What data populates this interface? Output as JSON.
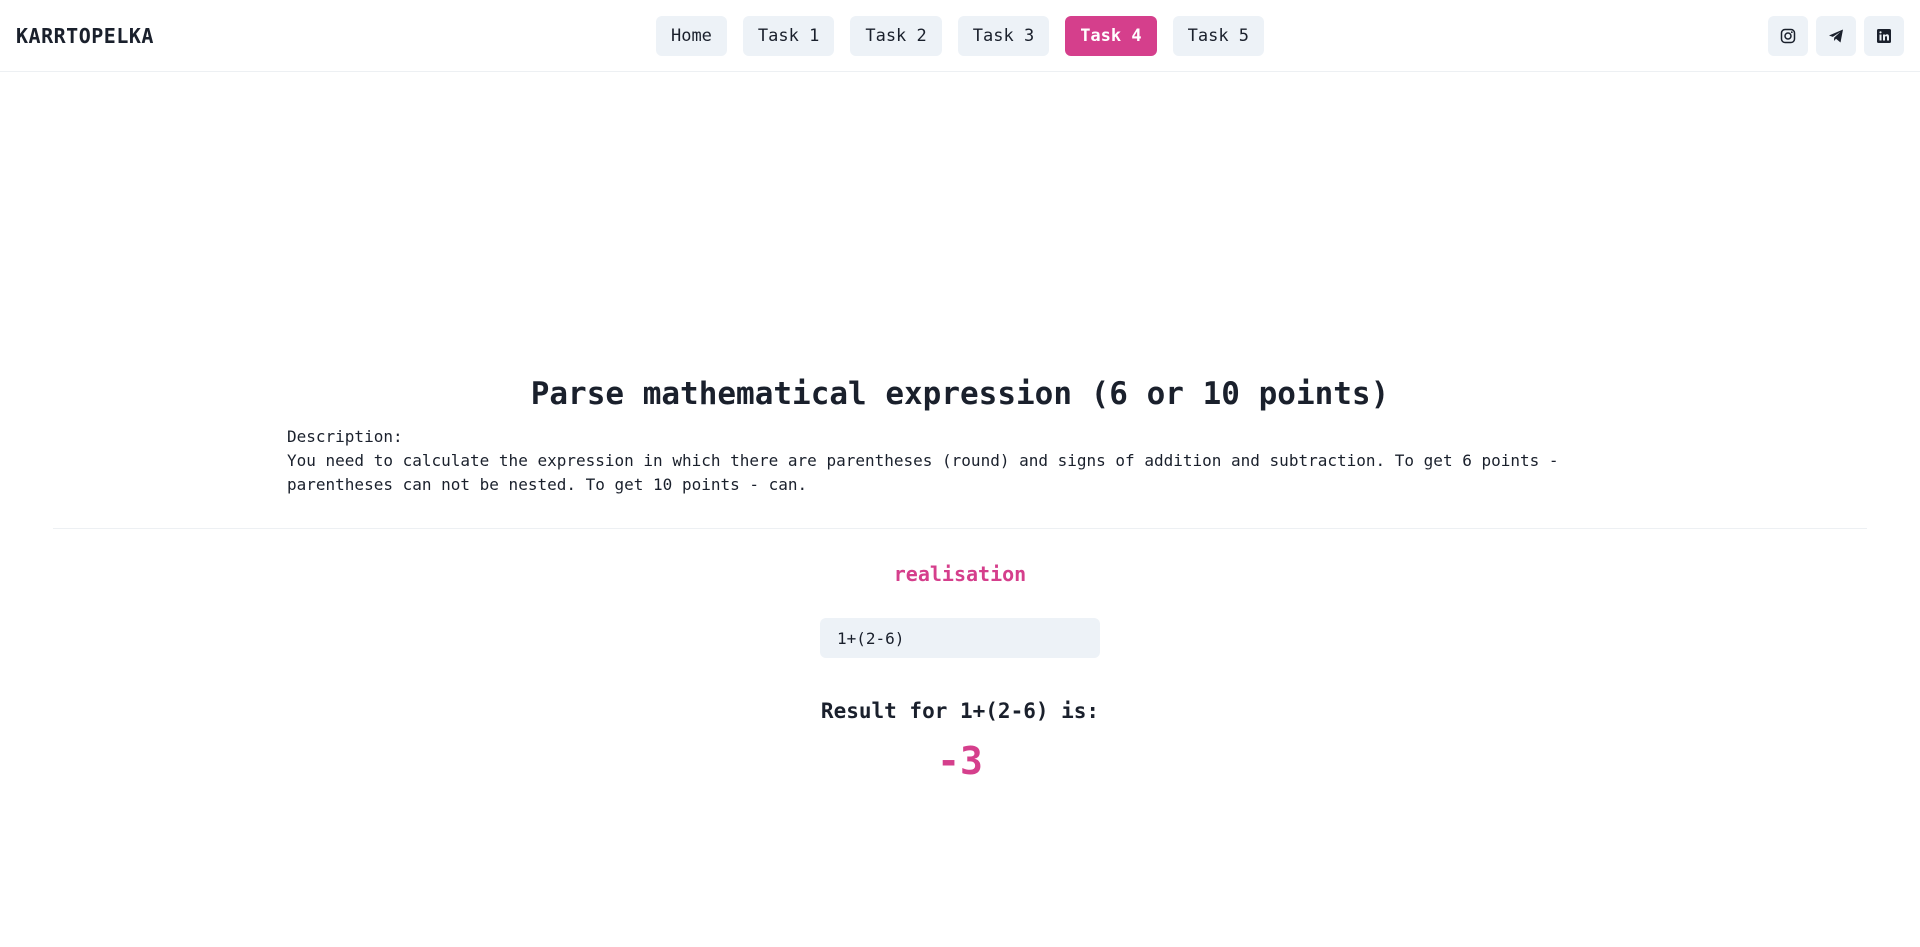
{
  "header": {
    "brand": "KARRTOPELKA",
    "nav": [
      {
        "label": "Home",
        "active": false
      },
      {
        "label": "Task 1",
        "active": false
      },
      {
        "label": "Task 2",
        "active": false
      },
      {
        "label": "Task 3",
        "active": false
      },
      {
        "label": "Task 4",
        "active": true
      },
      {
        "label": "Task 5",
        "active": false
      }
    ],
    "social_icons": [
      "instagram-icon",
      "telegram-icon",
      "linkedin-icon"
    ]
  },
  "task": {
    "title": "Parse mathematical expression (6 or 10 points)",
    "description_label": "Description:",
    "description_text": "You need to calculate the expression in which there are parentheses (round) and signs of addition and subtraction. To get 6 points - parentheses can not be nested. To get 10 points - can."
  },
  "realisation": {
    "heading": "realisation",
    "input_value": "1+(2-6)",
    "result_label": "Result for 1+(2-6) is:",
    "result_value": "-3"
  },
  "colors": {
    "accent": "#d53f8c",
    "button_bg": "#edf2f7",
    "text": "#1a202c"
  }
}
